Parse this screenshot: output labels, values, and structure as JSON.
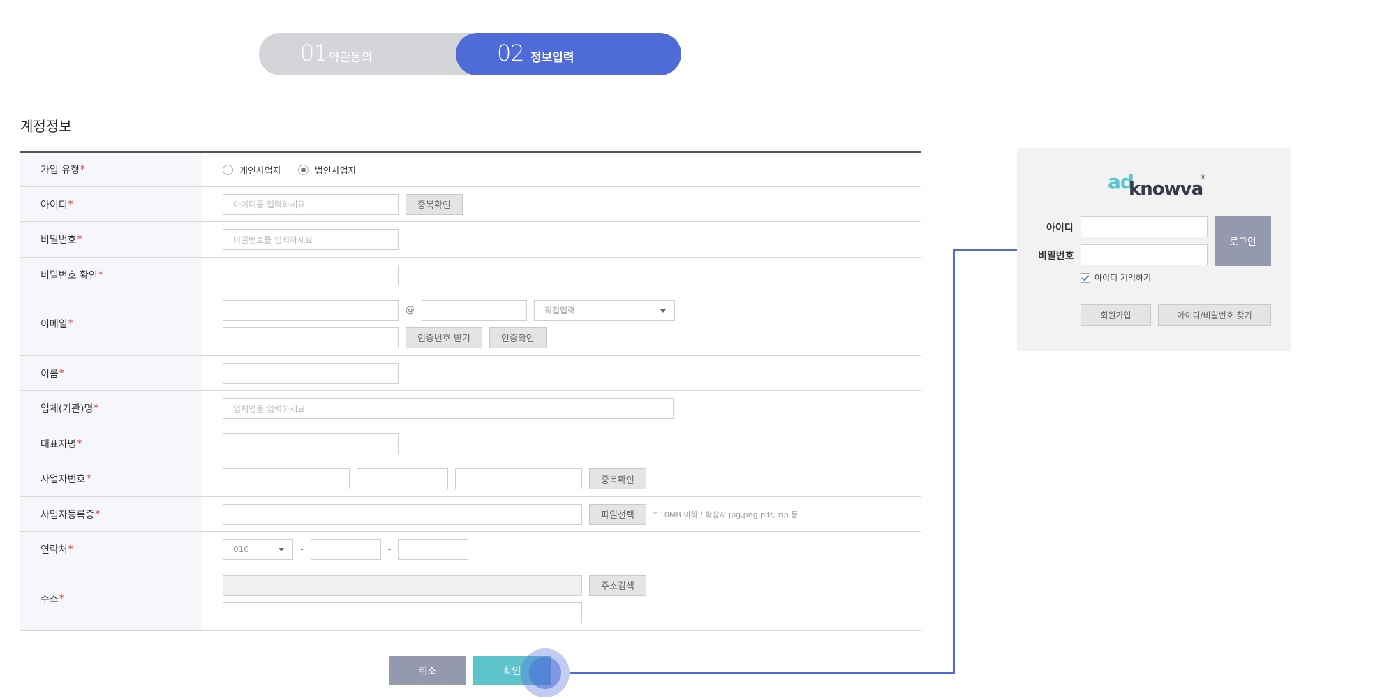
{
  "steps": [
    {
      "num": "01",
      "label": "약관동의"
    },
    {
      "num": "02",
      "label": "정보입력"
    }
  ],
  "section_title": "계정정보",
  "required_mark": "*",
  "form": {
    "join_type": {
      "label": "가입 유형",
      "options": [
        "개인사업자",
        "법인사업자"
      ],
      "selected": "법인사업자"
    },
    "user_id": {
      "label": "아이디",
      "placeholder": "아이디를 입력하세요",
      "check_button": "중복확인"
    },
    "password": {
      "label": "비밀번호",
      "placeholder": "비밀번호를 입력하세요"
    },
    "password_confirm": {
      "label": "비밀번호 확인"
    },
    "email": {
      "label": "이메일",
      "at": "@",
      "domain_select": "직접입력",
      "send_code_button": "인증번호 받기",
      "verify_button": "인증확인"
    },
    "name": {
      "label": "이름"
    },
    "company": {
      "label": "업체(기관)명",
      "placeholder": "업체명을 입력하세요"
    },
    "ceo": {
      "label": "대표자명"
    },
    "biz_number": {
      "label": "사업자번호",
      "check_button": "중복확인"
    },
    "biz_cert": {
      "label": "사업자등록증",
      "file_button": "파일선택",
      "note": "* 10MB 이하 / 확장자 jpg,png,pdf, zip 등"
    },
    "phone": {
      "label": "연락처",
      "prefix": "010",
      "dash": "-"
    },
    "address": {
      "label": "주소",
      "search_button": "주소검색"
    }
  },
  "buttons": {
    "cancel": "취소",
    "confirm": "확인"
  },
  "login_panel": {
    "logo_ad": "ad",
    "logo_rest": "knowva",
    "logo_reg": "®",
    "id_label": "아이디",
    "pw_label": "비밀번호",
    "login_button": "로그인",
    "remember_label": "아이디 기억하기",
    "remember_checked": true,
    "signup_button": "회원가입",
    "find_button": "아이디/비밀번호 찾기"
  },
  "colors": {
    "accent": "#4f6bd8",
    "teal": "#5ec4cc",
    "gray_button": "#9599ad",
    "required": "#e03131"
  }
}
